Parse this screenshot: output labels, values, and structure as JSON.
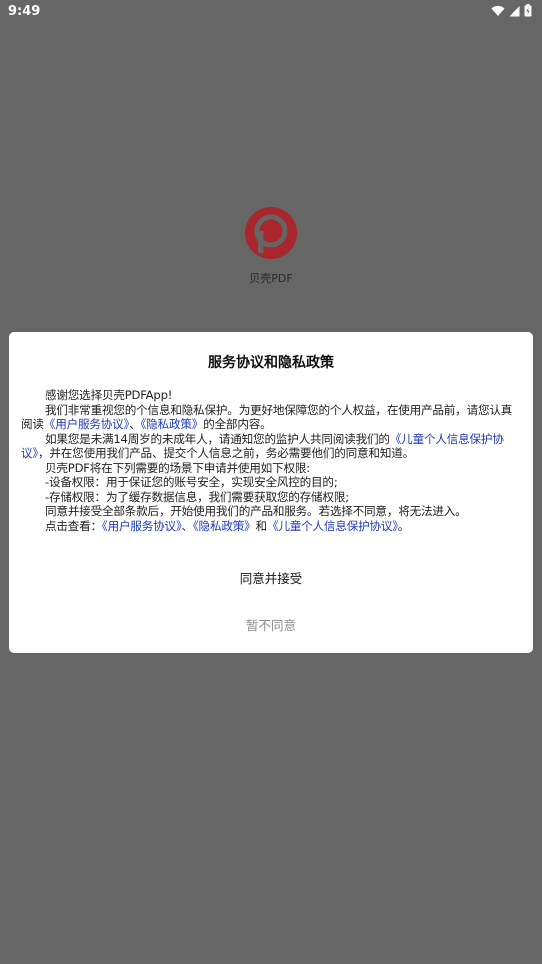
{
  "status_bar": {
    "time": "9:49"
  },
  "splash": {
    "app_name": "贝壳PDF"
  },
  "dialog": {
    "title": "服务协议和隐私政策",
    "p1": "感谢您选择贝壳PDFApp!",
    "p2": {
      "t1": "我们非常重视您的个信息和隐私保护。为更好地保障您的个人权益，在使用产品前，请您认真阅读",
      "link1": "《用户服务协议》",
      "t2": "、",
      "link2": "《隐私政策》",
      "t3": "的全部内容。"
    },
    "p3": {
      "t1": "如果您是未满14周岁的未成年人，请通知您的监护人共同阅读我们的",
      "link1": "《儿童个人信息保护协议》",
      "t2": "，并在您使用我们产品、提交个人信息之前，务必需要他们的同意和知道。"
    },
    "p4": "贝壳PDF将在下列需要的场景下申请并使用如下权限:",
    "p5": "-设备权限：用于保证您的账号安全，实现安全风控的目的;",
    "p6": "-存储权限：为了缓存数据信息，我们需要获取您的存储权限;",
    "p7": "同意并接受全部条款后，开始使用我们的产品和服务。若选择不同意，将无法进入。",
    "p8": {
      "t1": "点击查看：",
      "link1": "《用户服务协议》",
      "t2": "、",
      "link2": "《隐私政策》",
      "t3": "和",
      "link3": "《儿童个人信息保护协议》",
      "t4": "。"
    },
    "agree_label": "同意并接受",
    "decline_label": "暂不同意"
  },
  "colors": {
    "link": "#1f3bb8",
    "logo_red": "#a8262c",
    "overlay": "#666666"
  }
}
